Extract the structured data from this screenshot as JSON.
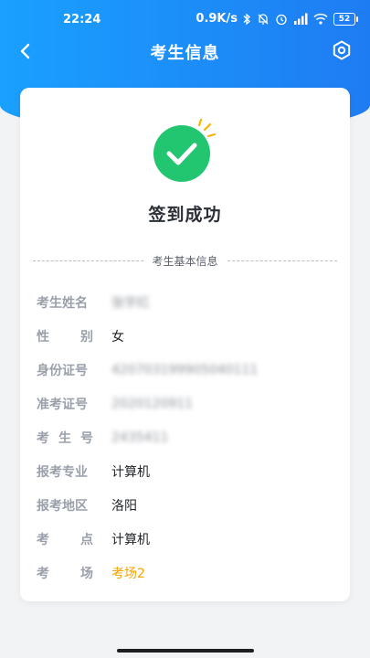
{
  "status_bar": {
    "time": "22:24",
    "network_speed": "0.9K/s",
    "battery": "52",
    "icons": [
      "bluetooth-icon",
      "bell-muted-icon",
      "alarm-icon",
      "signal-icon",
      "wifi-icon",
      "battery-icon"
    ]
  },
  "nav": {
    "title": "考生信息",
    "back_icon": "chevron-left-icon",
    "settings_icon": "settings-icon"
  },
  "card": {
    "success_title": "签到成功",
    "section_label": "考生基本信息",
    "accent_green": "#22c670",
    "accent_orange": "#f5a300",
    "rows": [
      {
        "label": "考生姓名",
        "value": "张宇红"
      },
      {
        "label": [
          "性",
          "别"
        ],
        "value": "女"
      },
      {
        "label": "身份证号",
        "value": "420703199905040111"
      },
      {
        "label": "准考证号",
        "value": "2020120911"
      },
      {
        "label": [
          "考",
          "生",
          "号"
        ],
        "value": "2435411"
      },
      {
        "label": "报考专业",
        "value": "计算机"
      },
      {
        "label": "报考地区",
        "value": "洛阳"
      },
      {
        "label": [
          "考",
          "点"
        ],
        "value": "计算机"
      },
      {
        "label": [
          "考",
          "场"
        ],
        "value": "考场2"
      }
    ]
  }
}
